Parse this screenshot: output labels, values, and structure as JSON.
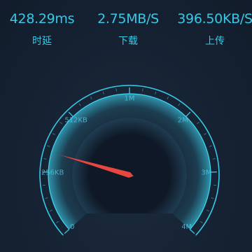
{
  "stats": {
    "latency": {
      "value": "428.29ms",
      "label": "时延"
    },
    "download": {
      "value": "2.75MB/S",
      "label": "下载"
    },
    "upload": {
      "value": "396.50KB/S",
      "label": "上传"
    }
  },
  "gauge": {
    "tick_labels": [
      "0",
      "256KB",
      "512KB",
      "1M",
      "2M",
      "3M",
      "4M"
    ],
    "needle_level_fraction": 0.22,
    "colors": {
      "accent": "#38c8e6",
      "needle": "#e8473f",
      "background": "#162233"
    }
  }
}
